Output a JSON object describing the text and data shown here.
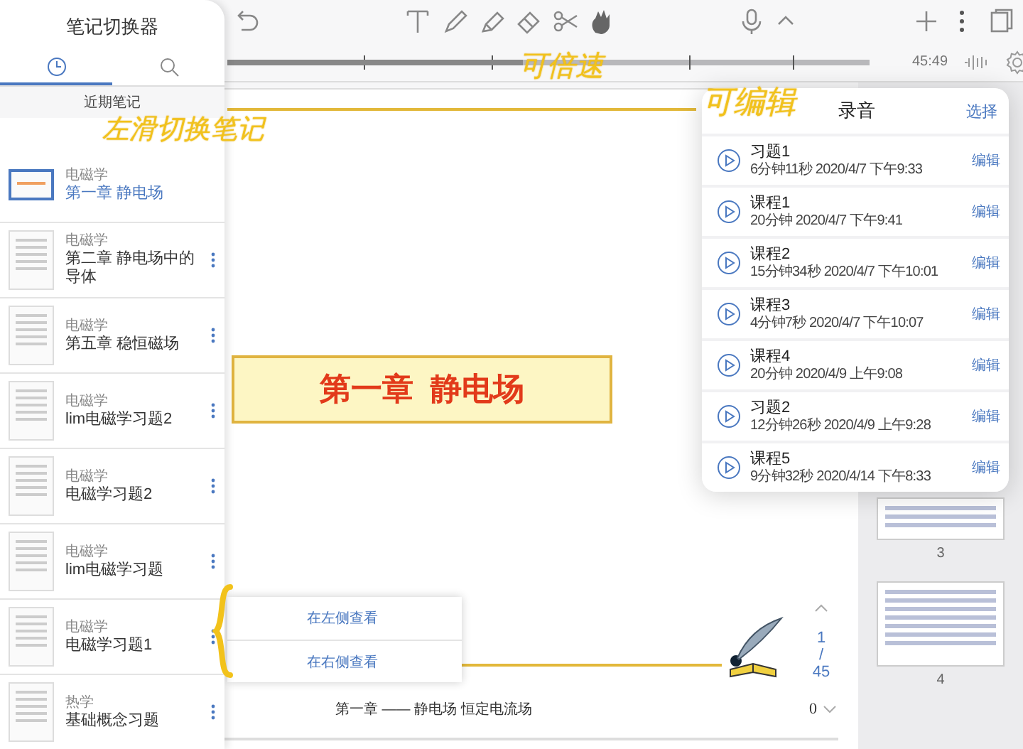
{
  "toolbar": {
    "time": "45:49"
  },
  "timeline": {
    "level": 0.46
  },
  "sidebar": {
    "title": "笔记切换器",
    "tabs": [
      {
        "kind": "recent",
        "selected": true
      },
      {
        "kind": "search",
        "selected": false
      }
    ],
    "section": "近期笔记",
    "items": [
      {
        "category": "电磁学",
        "title": "第一章 静电场",
        "selected": true,
        "menu": false
      },
      {
        "category": "电磁学",
        "title": "第二章 静电场中的导体",
        "selected": false,
        "menu": true
      },
      {
        "category": "电磁学",
        "title": "第五章 稳恒磁场",
        "selected": false,
        "menu": true
      },
      {
        "category": "电磁学",
        "title": "lim电磁学习题2",
        "selected": false,
        "menu": true
      },
      {
        "category": "电磁学",
        "title": "电磁学习题2",
        "selected": false,
        "menu": true
      },
      {
        "category": "电磁学",
        "title": "lim电磁学习题",
        "selected": false,
        "menu": true
      },
      {
        "category": "电磁学",
        "title": "电磁学习题1",
        "selected": false,
        "menu": true
      },
      {
        "category": "热学",
        "title": "基础概念习题",
        "selected": false,
        "menu": true
      }
    ]
  },
  "recordings": {
    "title": "录音",
    "action": "选择",
    "items": [
      {
        "title": "习题1",
        "detail": "6分钟11秒 2020/4/7 下午9:33",
        "edit": "编辑"
      },
      {
        "title": "课程1",
        "detail": "20分钟 2020/4/7 下午9:41",
        "edit": "编辑"
      },
      {
        "title": "课程2",
        "detail": "15分钟34秒 2020/4/7 下午10:01",
        "edit": "编辑"
      },
      {
        "title": "课程3",
        "detail": "4分钟7秒 2020/4/7 下午10:07",
        "edit": "编辑"
      },
      {
        "title": "课程4",
        "detail": "20分钟 2020/4/9 上午9:08",
        "edit": "编辑"
      },
      {
        "title": "习题2",
        "detail": "12分钟26秒 2020/4/9 上午9:28",
        "edit": "编辑"
      },
      {
        "title": "课程5",
        "detail": "9分钟32秒 2020/4/14 下午8:33",
        "edit": "编辑"
      }
    ]
  },
  "document": {
    "banner": "第一章  静电场",
    "context_menu": [
      "在左侧查看",
      "在右侧查看"
    ],
    "page": {
      "current": "1",
      "separator": "/",
      "total": "45"
    },
    "footer": "第一章 —— 静电场 恒定电流场",
    "footer_count": "0"
  },
  "thumbnails": [
    {
      "label": "3"
    },
    {
      "label": "4"
    }
  ],
  "annotations": [
    {
      "text": "左滑切换笔记"
    },
    {
      "text": "可倍速"
    },
    {
      "text": "可编辑"
    }
  ]
}
